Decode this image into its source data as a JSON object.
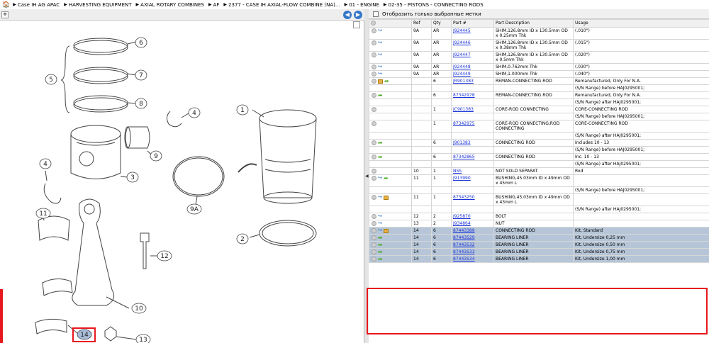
{
  "breadcrumb": [
    "Case IH AG APAC",
    "HARVESTING EQUIPMENT",
    "AXIAL ROTARY COMBINES",
    "AF",
    "2377 - CASE IH AXIAL-FLOW COMBINE (NA)...",
    "01 - ENGINE",
    "02-35 - PISTONS - CONNECTING RODS"
  ],
  "diagram": {
    "callouts": [
      "1",
      "2",
      "3",
      "4",
      "4",
      "5",
      "6",
      "7",
      "8",
      "9",
      "9A",
      "10",
      "11",
      "12",
      "13",
      "14"
    ]
  },
  "filter_label": "Отобразить только выбранные метки",
  "columns": [
    "Ref",
    "Qty",
    "Part #",
    "Part Description",
    "Usage"
  ],
  "rows": [
    {
      "ref": "9A",
      "qty": "AR",
      "part": "J924445",
      "desc": "SHIM,126.8mm ID x 130.5mm OD x 0.25mm Thk",
      "usage": "(.010\")",
      "icons": "a",
      "sel": false
    },
    {
      "ref": "9A",
      "qty": "AR",
      "part": "J924446",
      "desc": "SHIM,126.8mm ID x 130.5mm OD x 0.38mm Thk",
      "usage": "(.015\")",
      "icons": "a",
      "sel": false
    },
    {
      "ref": "9A",
      "qty": "AR",
      "part": "J924447",
      "desc": "SHIM,126.8mm ID x 130.5mm OD x 0.5mm Thk",
      "usage": "(.020\")",
      "icons": "a",
      "sel": false
    },
    {
      "ref": "9A",
      "qty": "AR",
      "part": "J924448",
      "desc": "SHIM,0.762mm Thk",
      "usage": "(.030\")",
      "icons": "a",
      "sel": false
    },
    {
      "ref": "9A",
      "qty": "AR",
      "part": "J924449",
      "desc": "SHIM,1.000mm Thk",
      "usage": "(.040\")",
      "icons": "a",
      "sel": false
    },
    {
      "ref": "",
      "qty": "6",
      "part": "JR901383",
      "desc": "REMAN-CONNECTING ROD",
      "usage": "Remanufactured, Only For N.A.",
      "icons": "bg",
      "sel": false
    },
    {
      "ref": "",
      "qty": "",
      "part": "",
      "desc": "",
      "usage": "(S/N Range) before HAJ0295001;",
      "icons": "",
      "sel": false
    },
    {
      "ref": "",
      "qty": "6",
      "part": "87342978",
      "desc": "REMAN-CONNECTING ROD",
      "usage": "Remanufactured, Only For N.A.",
      "icons": "g",
      "sel": false
    },
    {
      "ref": "",
      "qty": "",
      "part": "",
      "desc": "",
      "usage": "(S/N Range) after HAJ0295001;",
      "icons": "",
      "sel": false
    },
    {
      "ref": "",
      "qty": "1",
      "part": "JC901383",
      "desc": "CORE-ROD CONNECTING",
      "usage": "CORE-CONNECTING ROD",
      "icons": "",
      "sel": false
    },
    {
      "ref": "",
      "qty": "",
      "part": "",
      "desc": "",
      "usage": "(S/N Range) before HAJ0295001;",
      "icons": "",
      "sel": false
    },
    {
      "ref": "",
      "qty": "1",
      "part": "87342975",
      "desc": "CORE-ROD CONNECTING,ROD CONNECTING",
      "usage": "CORE-CONNECTING ROD",
      "icons": "",
      "sel": false
    },
    {
      "ref": "",
      "qty": "",
      "part": "",
      "desc": "",
      "usage": "(S/N Range) after HAJ0295001;",
      "icons": "",
      "sel": false
    },
    {
      "ref": "",
      "qty": "6",
      "part": "J901383",
      "desc": "CONNECTING ROD",
      "usage": "Includes 10 - 13",
      "icons": "g",
      "sel": false
    },
    {
      "ref": "",
      "qty": "",
      "part": "",
      "desc": "",
      "usage": "(S/N Range) before HAJ0295001;",
      "icons": "",
      "sel": false
    },
    {
      "ref": "",
      "qty": "6",
      "part": "87342865",
      "desc": "CONNECTING ROD",
      "usage": "Inc. 10 - 13",
      "icons": "g",
      "sel": false
    },
    {
      "ref": "",
      "qty": "",
      "part": "",
      "desc": "",
      "usage": "(S/N Range) after HAJ0295001;",
      "icons": "",
      "sel": false
    },
    {
      "ref": "10",
      "qty": "1",
      "part": "NSS",
      "desc": "NOT SOLD SEPARAT",
      "usage": "Rod",
      "icons": "",
      "sel": false
    },
    {
      "ref": "11",
      "qty": "1",
      "part": "J913990",
      "desc": "BUSHING,45.03mm ID x 49mm OD x 45mm L",
      "usage": "",
      "icons": "ag",
      "sel": false
    },
    {
      "ref": "",
      "qty": "",
      "part": "",
      "desc": "",
      "usage": "(S/N Range) before HAJ0295001;",
      "icons": "",
      "sel": false
    },
    {
      "ref": "11",
      "qty": "1",
      "part": "87343250",
      "desc": "BUSHING,45.03mm ID x 49mm OD x 43mm L",
      "usage": "",
      "icons": "ab",
      "sel": false
    },
    {
      "ref": "",
      "qty": "",
      "part": "",
      "desc": "",
      "usage": "(S/N Range) after HAJ0295001;",
      "icons": "",
      "sel": false
    },
    {
      "ref": "12",
      "qty": "2",
      "part": "J925870",
      "desc": "BOLT",
      "usage": "",
      "icons": "a",
      "sel": false
    },
    {
      "ref": "13",
      "qty": "2",
      "part": "J934864",
      "desc": "NUT",
      "usage": "",
      "icons": "a",
      "sel": false
    },
    {
      "ref": "14",
      "qty": "6",
      "part": "87443389",
      "desc": "CONNECTING ROD",
      "usage": "Kit, Standard",
      "icons": "ab",
      "sel": true
    },
    {
      "ref": "14",
      "qty": "6",
      "part": "87443529",
      "desc": "BEARING LINER",
      "usage": "Kit, Undersize 0,25 mm",
      "icons": "g",
      "sel": true
    },
    {
      "ref": "14",
      "qty": "6",
      "part": "87443532",
      "desc": "BEARING LINER",
      "usage": "Kit, Undersize 0,50 mm",
      "icons": "g",
      "sel": true
    },
    {
      "ref": "14",
      "qty": "6",
      "part": "87443533",
      "desc": "BEARING LINER",
      "usage": "Kit, Undersize 0,75 mm",
      "icons": "g",
      "sel": true
    },
    {
      "ref": "14",
      "qty": "6",
      "part": "87443534",
      "desc": "BEARING LINER",
      "usage": "Kit, Undersize 1,00 mm",
      "icons": "g",
      "sel": true
    }
  ]
}
